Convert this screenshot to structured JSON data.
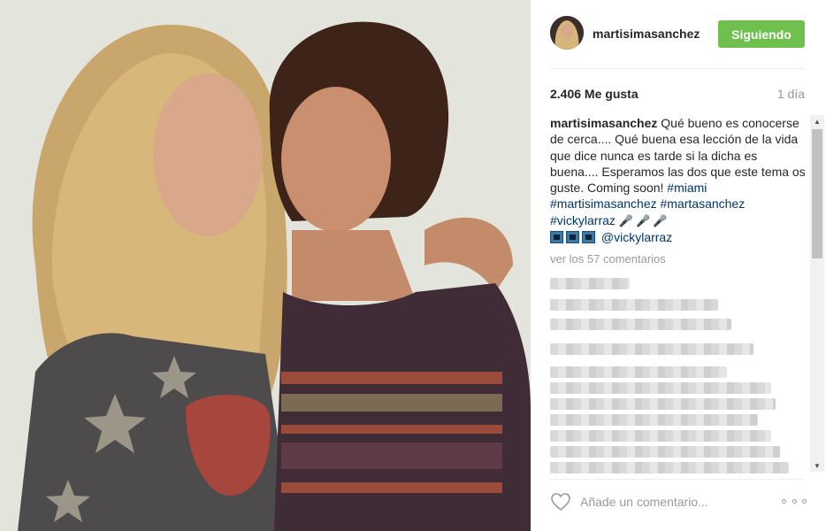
{
  "post": {
    "username": "martisimasanchez",
    "follow_label": "Siguiendo",
    "likes": "2.406 Me gusta",
    "time_ago": "1 día",
    "caption": {
      "user": "martisimasanchez",
      "text": " Qué bueno es conocerse de cerca.... Qué buena esa lección de la vida que dice nunca es tarde si la dicha es buena.... Esperamos las dos que este tema os guste. Coming soon! ",
      "tags": [
        "#miami",
        "#martisimasanchez",
        "#martasanchez",
        "#vickylarraz"
      ],
      "mention": "@vickylarraz"
    },
    "view_comments": "ver los 57 comentarios",
    "comment_placeholder": "Añade un comentario...",
    "icons": {
      "avatar": "profile-photo",
      "like": "heart-outline-icon",
      "options": "ellipsis-icon",
      "emoji_mic": "microphone-icon",
      "emoji_box": "blue-square-icon"
    }
  },
  "colors": {
    "follow_button": "#70c050",
    "hashtag": "#003569",
    "muted": "#999999"
  }
}
